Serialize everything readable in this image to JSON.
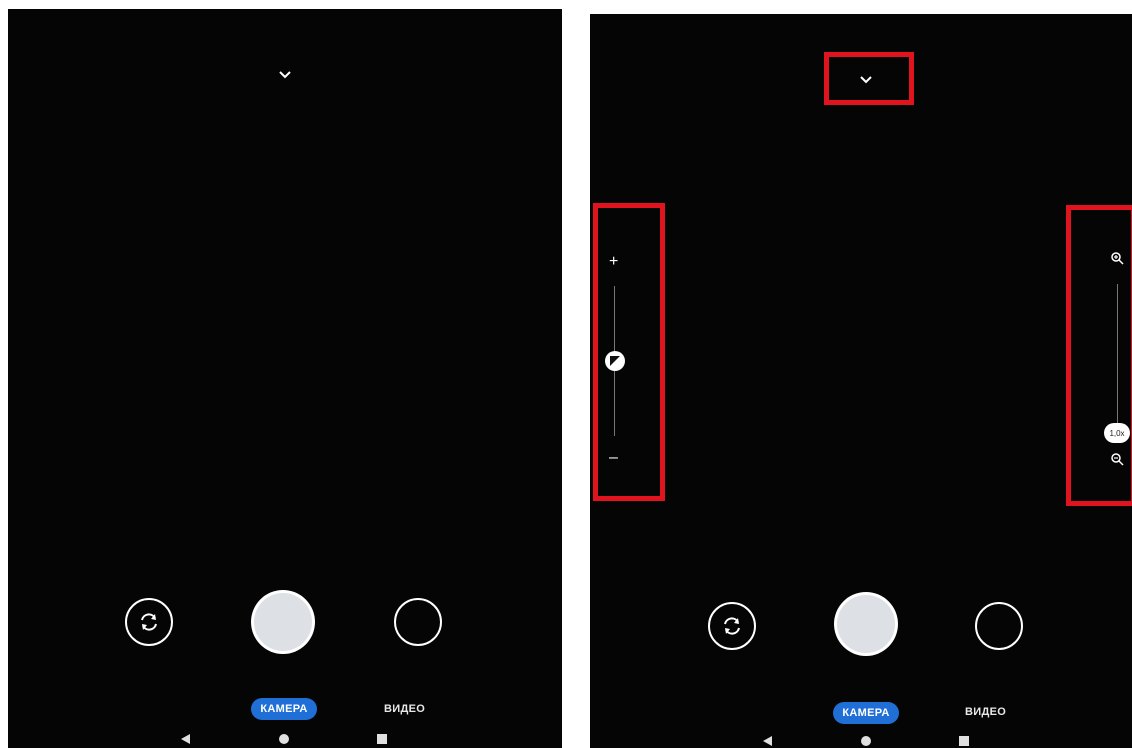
{
  "left_screen": {
    "modes": {
      "camera": "КАМЕРА",
      "video": "ВИДЕО"
    },
    "icons": {
      "chevron": "chevron-down-icon",
      "switch": "switch-camera-icon"
    }
  },
  "right_screen": {
    "modes": {
      "camera": "КАМЕРА",
      "video": "ВИДЕО"
    },
    "exposure": {
      "plus": "+",
      "minus": "–"
    },
    "zoom": {
      "value": "1,0x"
    },
    "icons": {
      "zoom_in": "zoom-in-icon",
      "zoom_out": "zoom-out-icon",
      "exposure": "exposure-icon"
    }
  },
  "colors": {
    "highlight": "#e0141e",
    "accent": "#1f6fd6"
  }
}
